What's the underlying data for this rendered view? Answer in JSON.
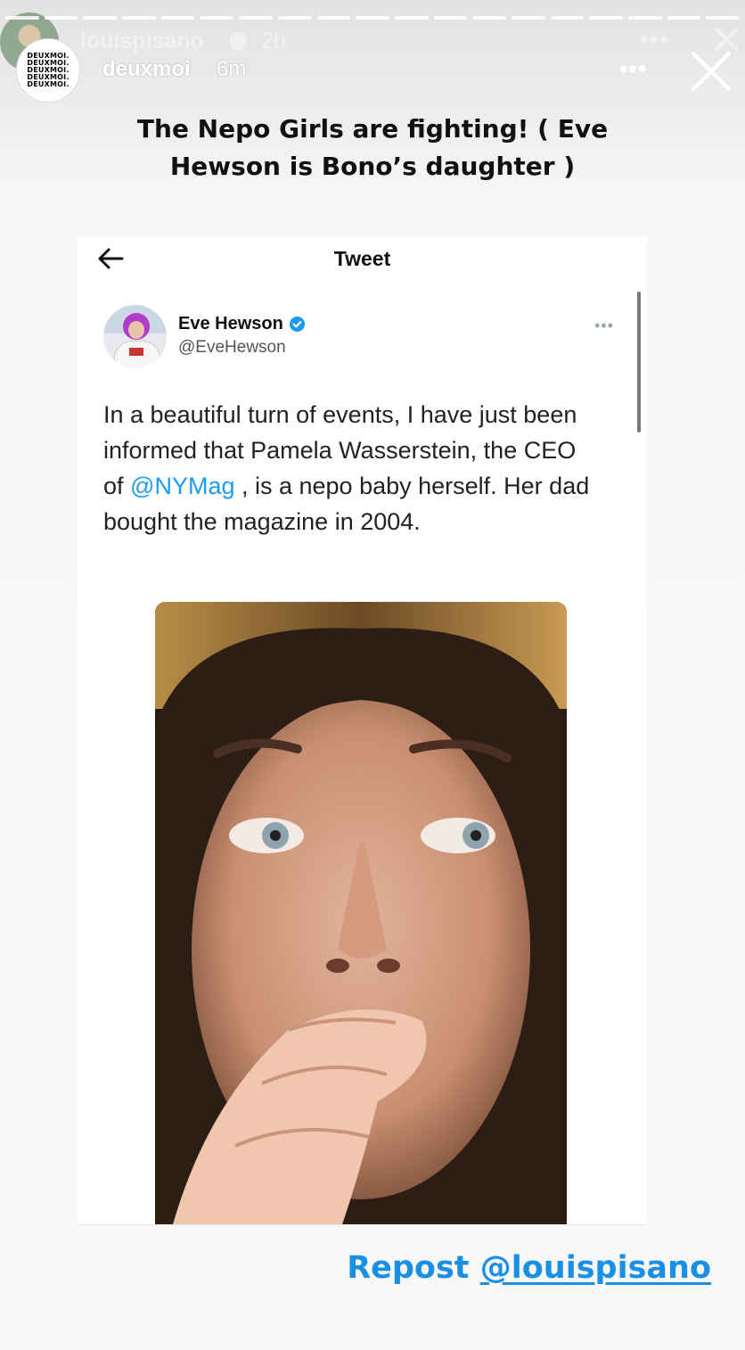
{
  "background_story": {
    "username": "louispisano",
    "time": "2h"
  },
  "header": {
    "avatar_text": [
      "DEUXMOI.",
      "DEUXMOI.",
      "DEUXMOI.",
      "DEUXMOI.",
      "DEUXMOI."
    ],
    "username": "deuxmoi",
    "time": "6m",
    "more_label": "•••",
    "progress_segments": 19
  },
  "caption": "The Nepo Girls are fighting!  ( Eve Hewson is Bono’s daughter )",
  "tweet_screen": {
    "title": "Tweet",
    "author_name": "Eve Hewson",
    "author_handle": "@EveHewson",
    "more_label": "•••",
    "text_before": "In a beautiful turn of events, I have just been informed that Pamela Wasserstein, the CEO of ",
    "mention": "@NYMag",
    "text_after": " , is a nepo baby herself. Her dad bought the magazine in 2004."
  },
  "repost": {
    "prefix": "Repost ",
    "handle": "@louispisano"
  },
  "colors": {
    "link": "#1d9bf0",
    "repost": "#1a8fe6",
    "verified": "#1d9bf0"
  }
}
